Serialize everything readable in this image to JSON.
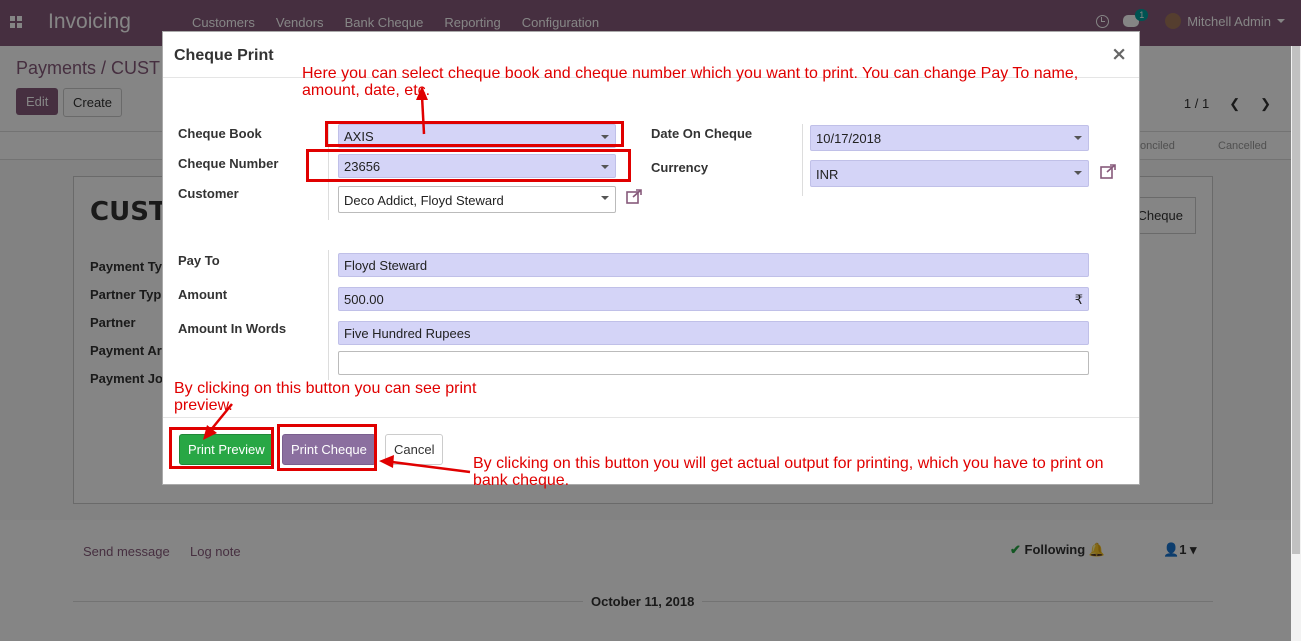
{
  "app": {
    "brand": "Invoicing",
    "menu": [
      "Customers",
      "Vendors",
      "Bank Cheque",
      "Reporting",
      "Configuration"
    ],
    "chat_badge": "1",
    "user_name": "Mitchell Admin"
  },
  "control_panel": {
    "breadcrumb": "Payments / CUST",
    "edit_label": "Edit",
    "create_label": "Create",
    "pager": "1 / 1",
    "status_steps": [
      "onciled",
      "Cancelled"
    ]
  },
  "sheet": {
    "title": "CUST.",
    "fields": [
      "Payment Ty",
      "Partner Typ",
      "Partner",
      "Payment Ar",
      "Payment Jo"
    ],
    "button_label": "Cheque"
  },
  "chatter": {
    "send_message": "Send message",
    "log_note": "Log note",
    "following": "Following",
    "followers_count": "1",
    "date_separator": "October 11, 2018"
  },
  "dialog": {
    "title": "Cheque Print",
    "close_label": "×",
    "left_labels": {
      "cheque_book": "Cheque Book",
      "cheque_number": "Cheque Number",
      "customer": "Customer",
      "pay_to": "Pay To",
      "amount": "Amount",
      "amount_in_words": "Amount In Words"
    },
    "right_labels": {
      "date_on_cheque": "Date On Cheque",
      "currency": "Currency"
    },
    "values": {
      "cheque_book": "AXIS",
      "cheque_number": "23656",
      "customer": "Deco Addict, Floyd Steward",
      "date_on_cheque": "10/17/2018",
      "currency": "INR",
      "pay_to": "Floyd Steward",
      "amount": "500.00",
      "currency_symbol": "₹",
      "amount_in_words": "Five Hundred Rupees",
      "extra_line": ""
    },
    "buttons": {
      "print_preview": "Print Preview",
      "print_cheque": "Print Cheque",
      "cancel": "Cancel"
    }
  },
  "annotations": {
    "top": "Here you can select cheque book and cheque number which you want to print. You can change Pay To name, amount, date, etc.",
    "preview": "By clicking on this button you can see print preview.",
    "print": "By clicking on this button you will get actual output for printing, which you have to print on bank cheque."
  },
  "colors": {
    "brand_purple": "#875a7b",
    "annotation_red": "#e00000",
    "required_field": "#d4d4f7",
    "preview_green": "#28a745"
  }
}
